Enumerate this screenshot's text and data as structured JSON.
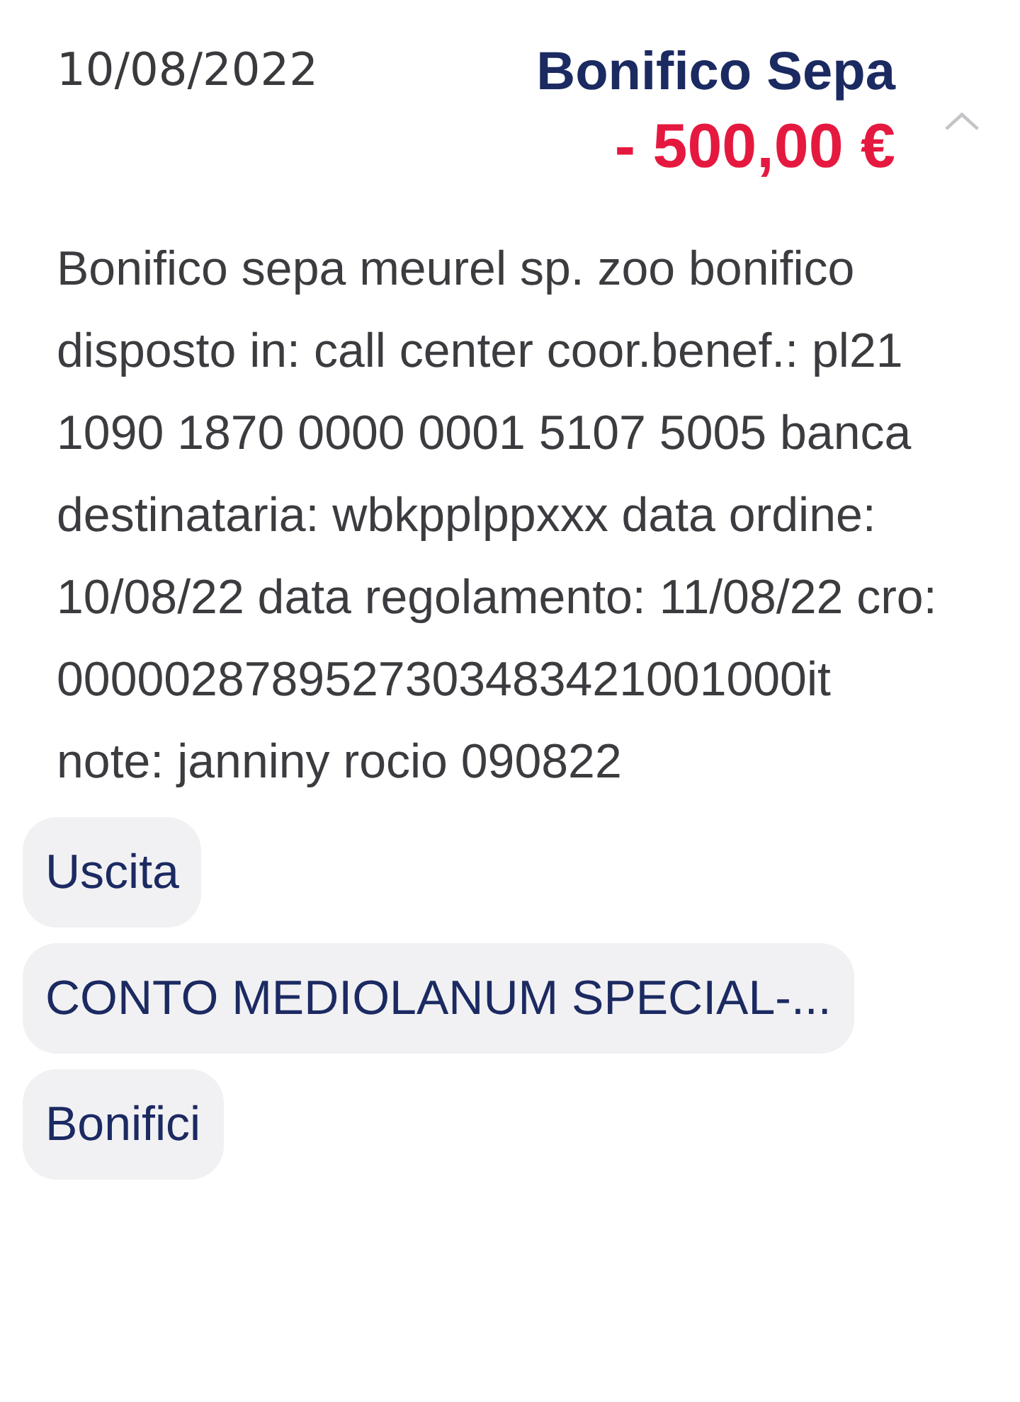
{
  "transaction": {
    "date": "10/08/2022",
    "title": "Bonifico Sepa",
    "amount": "- 500,00 €",
    "expanded": true,
    "description": "Bonifico sepa meurel sp. zoo bonifico disposto in: call center coor.benef.: pl21 1090 1870 0000 0001 5107 5005 banca destinataria: wbkpplppxxx data ordine: 10/08/22 data regolamento: 11/08/22 cro: 0000028789527303483421001000it note: janniny rocio 090822",
    "tags": [
      {
        "label": "Uscita"
      },
      {
        "label": "CONTO MEDIOLANUM SPECIAL-..."
      },
      {
        "label": "Bonifici"
      }
    ]
  }
}
